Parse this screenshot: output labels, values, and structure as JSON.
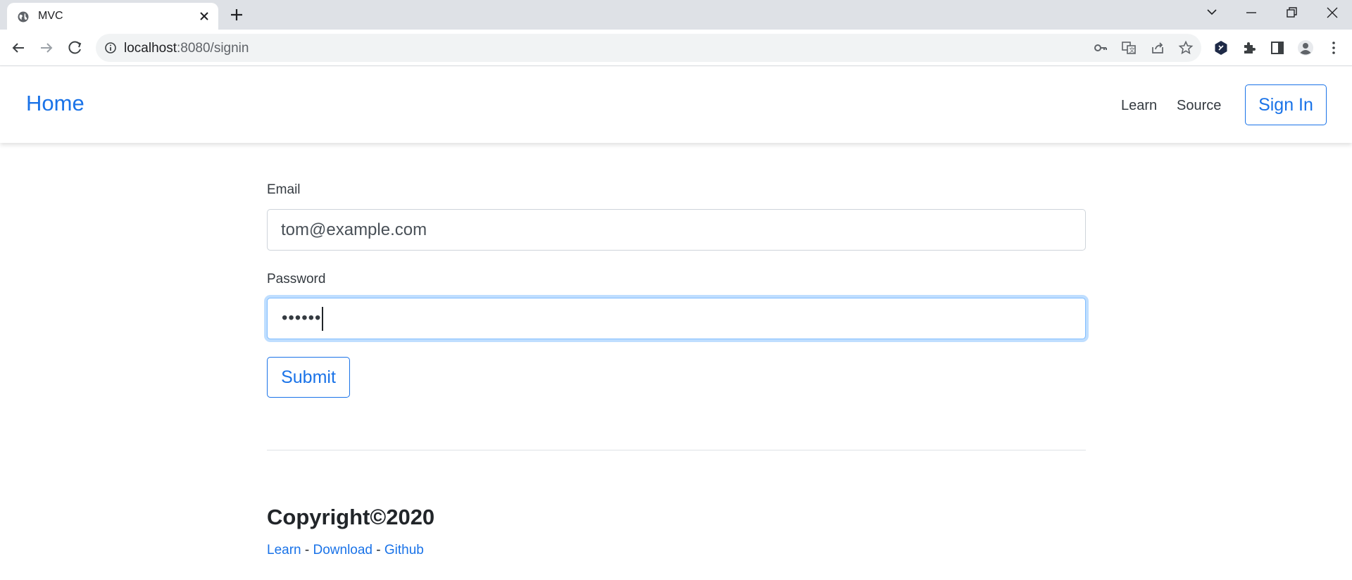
{
  "browser": {
    "tab_title": "MVC",
    "url_host": "localhost",
    "url_path": ":8080/signin"
  },
  "navbar": {
    "brand": "Home",
    "links": [
      "Learn",
      "Source"
    ],
    "signin_label": "Sign In"
  },
  "form": {
    "email_label": "Email",
    "email_value": "tom@example.com",
    "password_label": "Password",
    "password_masked": "••••••",
    "submit_label": "Submit"
  },
  "footer": {
    "copyright": "Copyright©2020",
    "links": [
      "Learn",
      "Download",
      "Github"
    ],
    "separator": " - "
  },
  "colors": {
    "accent": "#1a73e8",
    "chrome_bg": "#dee1e6"
  }
}
